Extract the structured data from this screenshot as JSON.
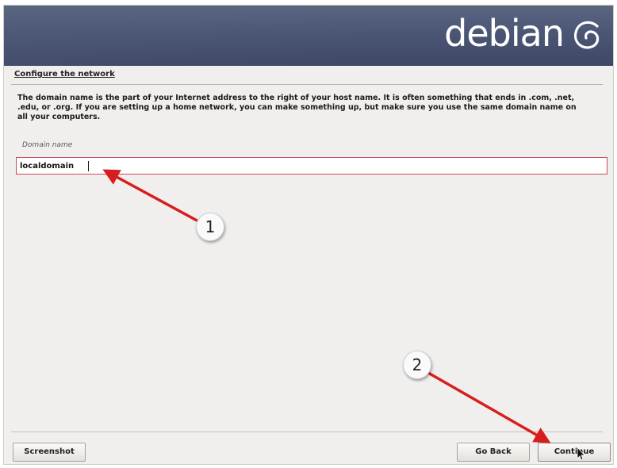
{
  "header": {
    "brand_text": "debian",
    "brand_icon": "debian-swirl-icon",
    "banner_color": "#4b5675"
  },
  "page": {
    "title": "Configure the network",
    "description": "The domain name is the part of your Internet address to the right of your host name.  It is often something that ends in .com, .net, .edu, or .org.  If you are setting up a home network, you can make something up, but make sure you use the same domain name on all your computers.",
    "field_label": "Domain name",
    "field_value": "localdomain",
    "field_border_color": "#c9495b"
  },
  "footer": {
    "screenshot_label": "Screenshot",
    "goback_label": "Go Back",
    "continue_label": "Continue"
  },
  "annotations": {
    "step1_label": "1",
    "step2_label": "2",
    "arrow_color": "#d71e1e"
  }
}
